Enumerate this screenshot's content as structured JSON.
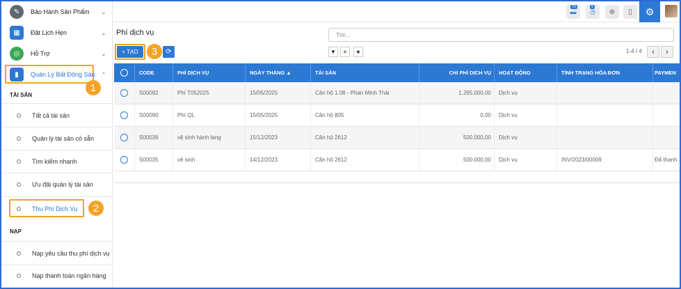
{
  "sidebar": {
    "menu": [
      {
        "label": "Bảo Hành Sản Phẩm",
        "icon": "wrench-icon",
        "color": "#5f6770",
        "glyph": "✎"
      },
      {
        "label": "Đặt Lịch Hẹn",
        "icon": "calendar-icon",
        "color": "#2c79d4",
        "glyph": "▦"
      },
      {
        "label": "Hỗ Trợ",
        "icon": "lifebuoy-icon",
        "color": "#3aa757",
        "glyph": "◎"
      },
      {
        "label": "Quản Lý Bất Động Sản",
        "icon": "building-icon",
        "color": "#2c79d4",
        "glyph": "▮"
      }
    ],
    "section_assets": "TÀI SẢN",
    "asset_items": [
      "Tất cả tài sản",
      "Quản lý tài sản có sẵn",
      "Tìm kiếm nhanh",
      "Ưu đãi quản lý tài sản",
      "Thu Phí Dịch Vụ"
    ],
    "section_deposit": "NẠP",
    "deposit_items": [
      "Nạp yêu cầu thu phí dịch vụ",
      "Nạp thanh toán ngân hàng"
    ]
  },
  "topbar": {
    "badge1": "73",
    "badge2": "5"
  },
  "page": {
    "title": "Phí dịch vụ",
    "search_placeholder": "Tìm...",
    "create_label": "+ TẠO",
    "pager": "1-4 / 4"
  },
  "steps": [
    "1",
    "2",
    "3"
  ],
  "table": {
    "columns": [
      "CODE",
      "PHÍ DỊCH VỤ",
      "NGÀY THÁNG ▲",
      "TÀI SẢN",
      "CHI PHÍ DỊCH VỤ",
      "HOẠT ĐỘNG",
      "TÌNH TRẠNG HÓA ĐƠN",
      "PAYMEN"
    ],
    "rows": [
      {
        "code": "S00092",
        "service": "Phí T052025",
        "date": "15/05/2025",
        "asset": "Căn hộ 1.08 - Phan Minh Thái",
        "cost": "1.265.000,00",
        "activity": "Dịch vụ",
        "invoice": "",
        "payment": ""
      },
      {
        "code": "S00090",
        "service": "Phí QL",
        "date": "15/05/2025",
        "asset": "Căn hộ 805",
        "cost": "0,00",
        "activity": "Dịch vụ",
        "invoice": "",
        "payment": ""
      },
      {
        "code": "S00036",
        "service": "vệ sinh hành lang",
        "date": "15/12/2023",
        "asset": "Căn hộ 2612",
        "cost": "500.000,00",
        "activity": "Dịch vụ",
        "invoice": "",
        "payment": ""
      },
      {
        "code": "S00035",
        "service": "vệ sinh",
        "date": "14/12/2023",
        "asset": "Căn hộ 2612",
        "cost": "500.000,00",
        "activity": "Dịch vụ",
        "invoice": "INV/2023/00009",
        "payment": "Đã thanh"
      }
    ]
  },
  "colors": {
    "accent": "#2c79d4",
    "highlight": "#f0a323"
  }
}
